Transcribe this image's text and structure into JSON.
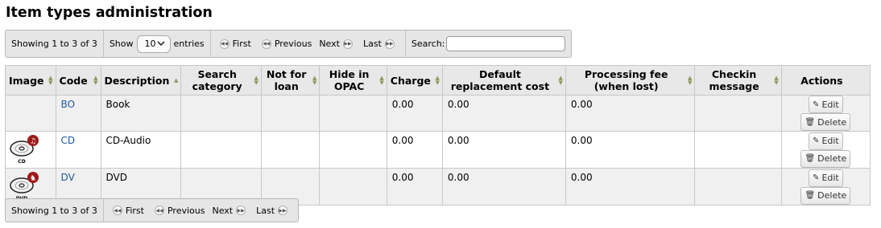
{
  "page": {
    "title": "Item types administration"
  },
  "pager_top": {
    "info": "Showing 1 to 3 of 3",
    "show_label": "Show",
    "length_value": "10",
    "entries_label": "entries",
    "first": "First",
    "previous": "Previous",
    "next": "Next",
    "last": "Last",
    "search_label": "Search:",
    "search_value": ""
  },
  "pager_bottom": {
    "info": "Showing 1 to 3 of 3",
    "first": "First",
    "previous": "Previous",
    "next": "Next",
    "last": "Last"
  },
  "table": {
    "headers": {
      "image": "Image",
      "code": "Code",
      "description": "Description",
      "search_category": "Search category",
      "not_for_loan": "Not for loan",
      "hide_in_opac": "Hide in OPAC",
      "charge": "Charge",
      "default_replacement_cost": "Default replacement cost",
      "processing_fee": "Processing fee (when lost)",
      "checkin_message": "Checkin message",
      "actions": "Actions"
    },
    "rows": [
      {
        "image": "",
        "code": "BO",
        "description": "Book",
        "search_category": "",
        "not_for_loan": "",
        "hide_in_opac": "",
        "charge": "0.00",
        "default_replacement_cost": "0.00",
        "processing_fee": "0.00",
        "checkin_message": "",
        "edit": "Edit",
        "delete": "Delete"
      },
      {
        "image": "cd-disc-icon",
        "image_label": "CD",
        "code": "CD",
        "description": "CD-Audio",
        "search_category": "",
        "not_for_loan": "",
        "hide_in_opac": "",
        "charge": "0.00",
        "default_replacement_cost": "0.00",
        "processing_fee": "0.00",
        "checkin_message": "",
        "edit": "Edit",
        "delete": "Delete"
      },
      {
        "image": "dvd-disc-icon",
        "image_label": "DVD",
        "code": "DV",
        "description": "DVD",
        "search_category": "",
        "not_for_loan": "",
        "hide_in_opac": "",
        "charge": "0.00",
        "default_replacement_cost": "0.00",
        "processing_fee": "0.00",
        "checkin_message": "",
        "edit": "Edit",
        "delete": "Delete"
      }
    ]
  },
  "colors": {
    "link": "#1f5aa1",
    "badge": "#9e1b1b",
    "header_bg": "#e8e8e8",
    "odd_row": "#f0f0f0"
  }
}
